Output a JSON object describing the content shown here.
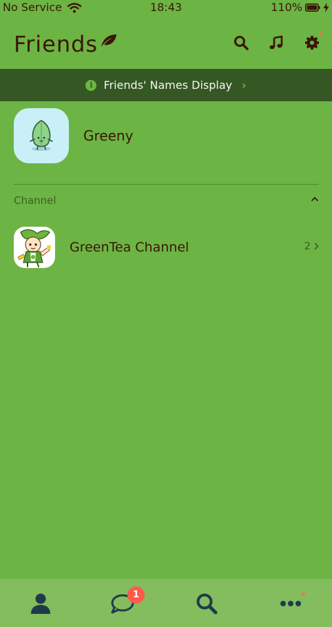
{
  "status_bar": {
    "carrier": "No Service",
    "time": "18:43",
    "battery": "110%"
  },
  "header": {
    "title": "Friends",
    "icons": [
      "leaf-icon",
      "search-icon",
      "music-icon",
      "gear-icon"
    ]
  },
  "banner": {
    "text": "Friends' Names Display"
  },
  "profile": {
    "name": "Greeny"
  },
  "channel_section": {
    "label": "Channel",
    "items": [
      {
        "name": "GreenTea Channel",
        "count": "2"
      }
    ]
  },
  "tab_bar": {
    "tabs": [
      "friends",
      "chats",
      "search",
      "more"
    ],
    "chats_badge": "1"
  },
  "colors": {
    "background": "#6cb444",
    "banner": "#345723",
    "tab_bar": "#83bd5d",
    "text": "#3a1608",
    "badge": "#ff5a4a"
  }
}
